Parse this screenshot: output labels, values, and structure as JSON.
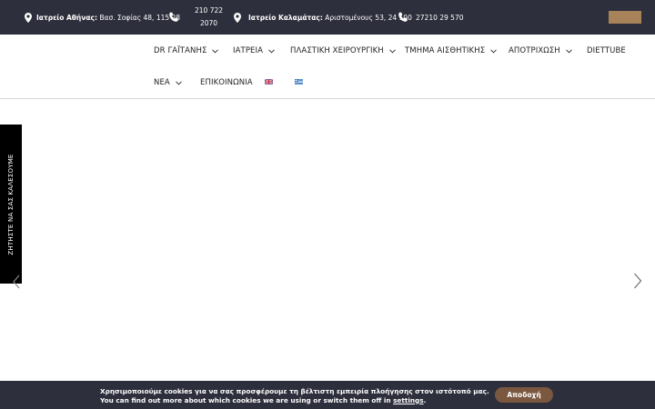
{
  "topbar": {
    "athens_label": "Ιατρείο Αθήνας:",
    "athens_address": "Βασ. Σοφίας 48, 115 28",
    "athens_phone_line1": "210 722",
    "athens_phone_line2": "2070",
    "kalamata_label": "Ιατρείο Καλαμάτας:",
    "kalamata_address": "Αριστομένους 53, 24 100",
    "kalamata_phone": "27210 29 570",
    "accent_color": "#a88359"
  },
  "nav": {
    "items": [
      {
        "label": "DR ΓΑΪΤΑΝΗΣ"
      },
      {
        "label": "ΙΑΤΡΕΙΑ"
      },
      {
        "label": "ΠΛΑΣΤΙΚΗ ΧΕΙΡΟΥΡΓΙΚΗ"
      },
      {
        "label": "ΤΜΗΜΑ ΑΙΣΘΗΤΙΚΗΣ"
      },
      {
        "label": "ΑΠΟΤΡΙΧΩΣΗ"
      },
      {
        "label": "DIETTUBE"
      },
      {
        "label": "ΝΕΑ"
      },
      {
        "label": "ΕΠΙΚΟΙΝΩΝΙΑ"
      }
    ],
    "flags": [
      "english-flag-icon",
      "greek-flag-icon"
    ]
  },
  "sidetab": {
    "label": "ΖΗΤΗΣΤΕ ΝΑ ΣΑΣ ΚΑΛΕΣΟΥΜΕ"
  },
  "cookie": {
    "line1": "Χρησιμοποιούμε cookies για να σας προσφέρουμε τη βέλτιστη εμπειρία πλοήγησης στον ιστότοπό μας.",
    "line2_prefix": "You can find out more about which cookies we are using or switch them off in ",
    "settings_link": "settings",
    "line2_suffix": ".",
    "accept_label": "Αποδοχή",
    "accept_color": "#7a5840"
  }
}
